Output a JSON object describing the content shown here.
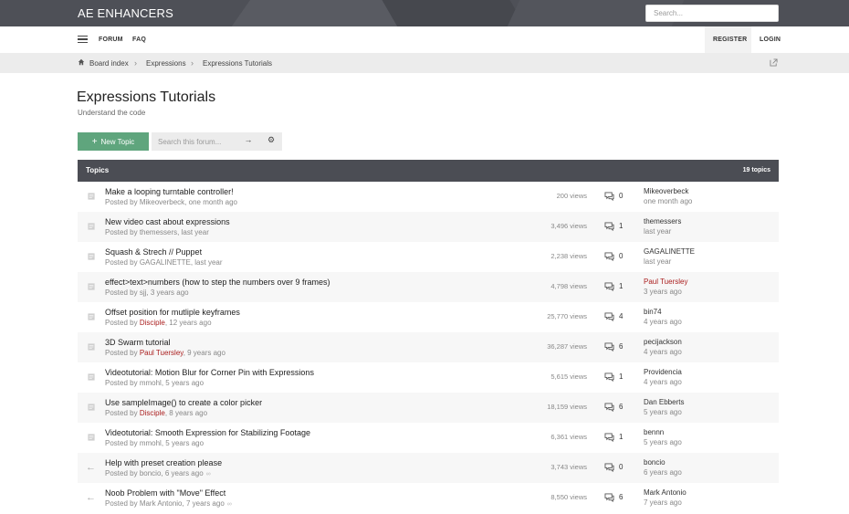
{
  "header": {
    "logo": "AE ENHANCERS",
    "search_placeholder": "Search..."
  },
  "nav": {
    "forum": "FORUM",
    "faq": "FAQ",
    "register": "REGISTER",
    "login": "LOGIN"
  },
  "breadcrumb": {
    "items": [
      "Board index",
      "Expressions",
      "Expressions Tutorials"
    ]
  },
  "page": {
    "title": "Expressions Tutorials",
    "subtitle": "Understand the code"
  },
  "actions": {
    "new_topic": "New Topic",
    "search_placeholder": "Search this forum..."
  },
  "topics": {
    "header": "Topics",
    "count": "19 topics",
    "rows": [
      {
        "title": "Make a looping turntable controller!",
        "posted_prefix": "Posted by ",
        "author": "Mikeoverbeck",
        "author_red": false,
        "time": ", one month ago",
        "views": "200 views",
        "replies": "0",
        "last_user": "Mikeoverbeck",
        "last_user_red": false,
        "last_time": "one month ago",
        "icon": "topic"
      },
      {
        "title": "New video cast about expressions",
        "posted_prefix": "Posted by ",
        "author": "themessers",
        "author_red": false,
        "time": ", last year",
        "views": "3,496 views",
        "replies": "1",
        "last_user": "themessers",
        "last_user_red": false,
        "last_time": "last year",
        "icon": "topic"
      },
      {
        "title": "Squash & Strech // Puppet",
        "posted_prefix": "Posted by ",
        "author": "GAGALINETTE",
        "author_red": false,
        "time": ", last year",
        "views": "2,238 views",
        "replies": "0",
        "last_user": "GAGALINETTE",
        "last_user_red": false,
        "last_time": "last year",
        "icon": "topic"
      },
      {
        "title": "effect>text>numbers (how to step the numbers over 9 frames)",
        "posted_prefix": "Posted by ",
        "author": "sjj",
        "author_red": false,
        "time": ", 3 years ago",
        "views": "4,798 views",
        "replies": "1",
        "last_user": "Paul Tuersley",
        "last_user_red": true,
        "last_time": "3 years ago",
        "icon": "topic"
      },
      {
        "title": "Offset position for mutliple keyframes",
        "posted_prefix": "Posted by ",
        "author": "Disciple",
        "author_red": true,
        "time": ", 12 years ago",
        "views": "25,770 views",
        "replies": "4",
        "last_user": "bin74",
        "last_user_red": false,
        "last_time": "4 years ago",
        "icon": "topic"
      },
      {
        "title": "3D Swarm tutorial",
        "posted_prefix": "Posted by ",
        "author": "Paul Tuersley",
        "author_red": true,
        "time": ", 9 years ago",
        "views": "36,287 views",
        "replies": "6",
        "last_user": "pecijackson",
        "last_user_red": false,
        "last_time": "4 years ago",
        "icon": "topic"
      },
      {
        "title": "Videotutorial: Motion Blur for Corner Pin with Expressions",
        "posted_prefix": "Posted by ",
        "author": "mmohl",
        "author_red": false,
        "time": ", 5 years ago",
        "views": "5,615 views",
        "replies": "1",
        "last_user": "Providencia",
        "last_user_red": false,
        "last_time": "4 years ago",
        "icon": "topic"
      },
      {
        "title": "Use sampleImage() to create a color picker",
        "posted_prefix": "Posted by ",
        "author": "Disciple",
        "author_red": true,
        "time": ", 8 years ago",
        "views": "18,159 views",
        "replies": "6",
        "last_user": "Dan Ebberts",
        "last_user_red": false,
        "last_time": "5 years ago",
        "icon": "topic"
      },
      {
        "title": "Videotutorial: Smooth Expression for Stabilizing Footage",
        "posted_prefix": "Posted by ",
        "author": "mmohl",
        "author_red": false,
        "time": ", 5 years ago",
        "views": "6,361 views",
        "replies": "1",
        "last_user": "bennn",
        "last_user_red": false,
        "last_time": "5 years ago",
        "icon": "topic"
      },
      {
        "title": "Help with preset creation please",
        "posted_prefix": "Posted by ",
        "author": "boncio",
        "author_red": false,
        "time": ", 6 years ago",
        "views": "3,743 views",
        "replies": "0",
        "last_user": "boncio",
        "last_user_red": false,
        "last_time": "6 years ago",
        "icon": "moved",
        "attachment": true
      },
      {
        "title": "Noob Problem with \"Move\" Effect",
        "posted_prefix": "Posted by ",
        "author": "Mark Antonio",
        "author_red": false,
        "time": ", 7 years ago",
        "views": "8,550 views",
        "replies": "6",
        "last_user": "Mark Antonio",
        "last_user_red": false,
        "last_time": "7 years ago",
        "icon": "moved",
        "attachment": true
      }
    ]
  },
  "colors": {
    "accent_green": "#5fa57d",
    "header_dark": "#4b4d54",
    "username_red": "#aa1e1e"
  }
}
